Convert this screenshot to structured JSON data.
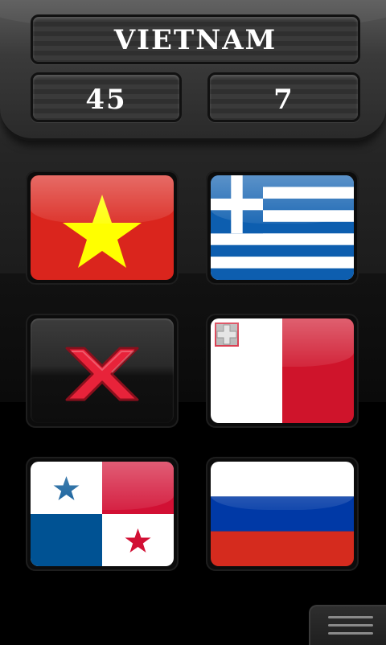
{
  "header": {
    "country_name": "VIETNAM",
    "score": "45",
    "remaining": "7"
  },
  "tiles": [
    {
      "flag": "vietnam",
      "state": "option"
    },
    {
      "flag": "greece",
      "state": "option"
    },
    {
      "flag": "none",
      "state": "wrong-answer"
    },
    {
      "flag": "malta",
      "state": "option"
    },
    {
      "flag": "panama",
      "state": "option"
    },
    {
      "flag": "russia",
      "state": "option"
    }
  ],
  "colors": {
    "vietnam_red": "#da251d",
    "vietnam_star": "#ffff00",
    "greece_blue": "#0d5eaf",
    "malta_red": "#cf142b",
    "panama_red": "#d21034",
    "panama_blue": "#005293",
    "russia_blue": "#0039a6",
    "russia_red": "#d52b1e",
    "wrong_x": "#e8233a"
  },
  "icons": {
    "wrong_mark": "x-icon",
    "menu": "hamburger-menu-icon"
  }
}
